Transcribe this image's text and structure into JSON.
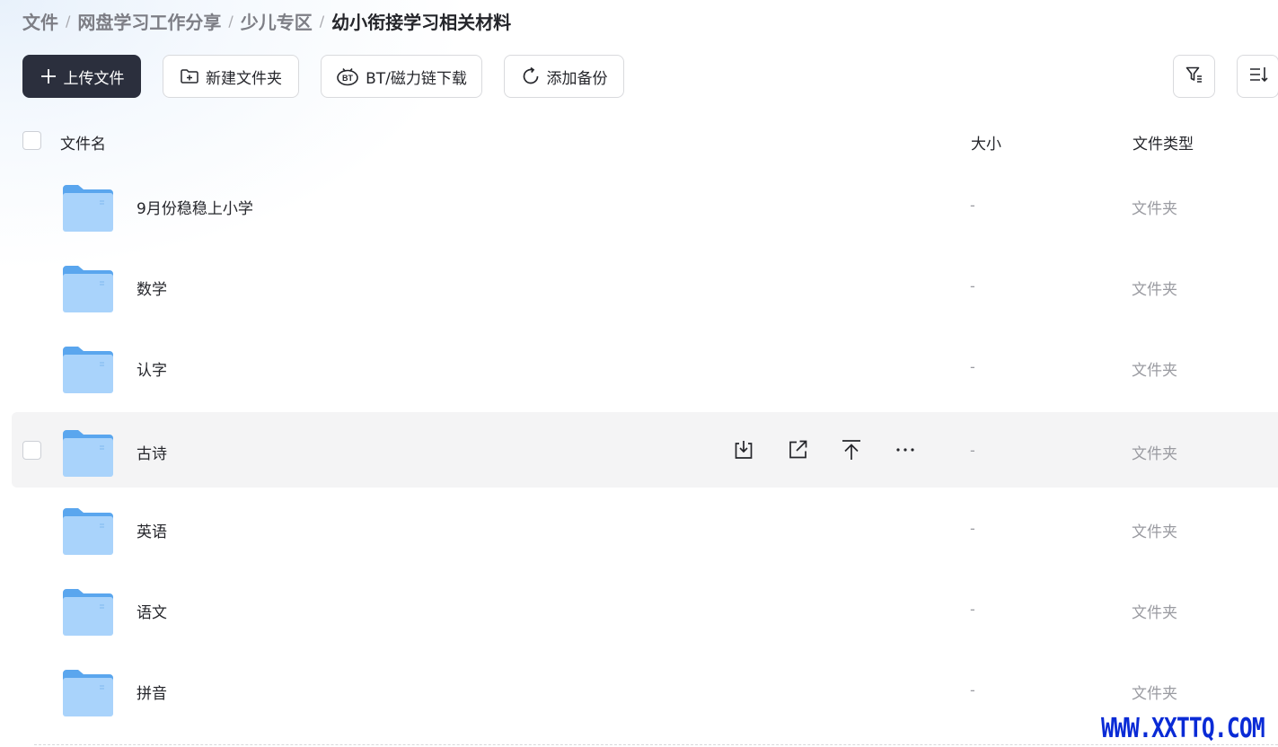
{
  "breadcrumb": {
    "items": [
      "文件",
      "网盘学习工作分享",
      "少儿专区"
    ],
    "current": "幼小衔接学习相关材料",
    "separator": "/"
  },
  "toolbar": {
    "upload_label": "上传文件",
    "new_folder_label": "新建文件夹",
    "bt_download_label": "BT/磁力链下载",
    "add_backup_label": "添加备份",
    "filter_icon": "filter-icon",
    "sort_icon": "sort-icon"
  },
  "list": {
    "header": {
      "name": "文件名",
      "size": "大小",
      "type": "文件类型"
    },
    "rows": [
      {
        "name": "9月份稳稳上小学",
        "size": "-",
        "type": "文件夹"
      },
      {
        "name": "数学",
        "size": "-",
        "type": "文件夹"
      },
      {
        "name": "认字",
        "size": "-",
        "type": "文件夹"
      },
      {
        "name": "古诗",
        "size": "-",
        "type": "文件夹",
        "hovered": true
      },
      {
        "name": "英语",
        "size": "-",
        "type": "文件夹"
      },
      {
        "name": "语文",
        "size": "-",
        "type": "文件夹"
      },
      {
        "name": "拼音",
        "size": "-",
        "type": "文件夹"
      }
    ],
    "hover_actions": [
      "download-icon",
      "share-icon",
      "move-to-top-icon",
      "more-icon"
    ]
  },
  "watermark": "WWW.XXTTQ.COM",
  "colors": {
    "primary_button": "#2b2f3d",
    "folder_light": "#a9d3fb",
    "folder_dark": "#5aa6ee",
    "muted_text": "#9a9ba1",
    "watermark": "#0a2bd6"
  }
}
